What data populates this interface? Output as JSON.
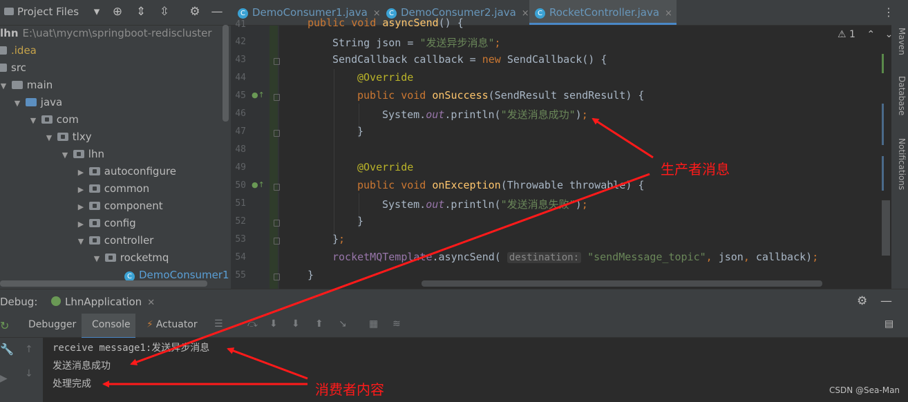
{
  "project": {
    "title": "Project Files",
    "root_name": "lhn",
    "root_path": "E:\\uat\\mycm\\springboot-rediscluster",
    "items": [
      {
        "label": ".idea"
      },
      {
        "label": "src"
      },
      {
        "label": "main"
      },
      {
        "label": "java"
      },
      {
        "label": "com"
      },
      {
        "label": "tlxy"
      },
      {
        "label": "lhn"
      },
      {
        "label": "autoconfigure"
      },
      {
        "label": "common"
      },
      {
        "label": "component"
      },
      {
        "label": "config"
      },
      {
        "label": "controller"
      },
      {
        "label": "rocketmq"
      },
      {
        "label": "DemoConsumer1"
      }
    ]
  },
  "tabs": [
    {
      "label": "DemoConsumer1.java",
      "close": "×"
    },
    {
      "label": "DemoConsumer2.java",
      "close": "×"
    },
    {
      "label": "RocketController.java",
      "close": "×"
    }
  ],
  "editor": {
    "warnings": "⚠ 1",
    "line_numbers": [
      "41",
      "42",
      "43",
      "44",
      "45",
      "46",
      "47",
      "48",
      "49",
      "50",
      "51",
      "52",
      "53",
      "54",
      "55"
    ],
    "hint_destination": "destination:",
    "strings": {
      "json_value": "\"发送异步消息\"",
      "success_msg": "\"发送消息成功\"",
      "fail_msg": "\"发送消息失败\"",
      "topic": "\"sendMessage_topic\""
    }
  },
  "side_labels": [
    "Maven",
    "Database",
    "Notifications"
  ],
  "debug": {
    "label": "Debug:",
    "app_name": "LhnApplication",
    "tabs": [
      "Debugger",
      "Console",
      "Actuator"
    ],
    "console_lines": [
      "receive message1:发送异步消息",
      "发送消息成功",
      "处理完成"
    ]
  },
  "annotations": {
    "producer": "生产者消息",
    "consumer": "消费者内容"
  },
  "watermark": "CSDN @Sea-Man",
  "colors": {
    "annotation_red": "#ff1a1a",
    "accent": "#4a88c7",
    "editor_bg": "#2b2b2b"
  }
}
